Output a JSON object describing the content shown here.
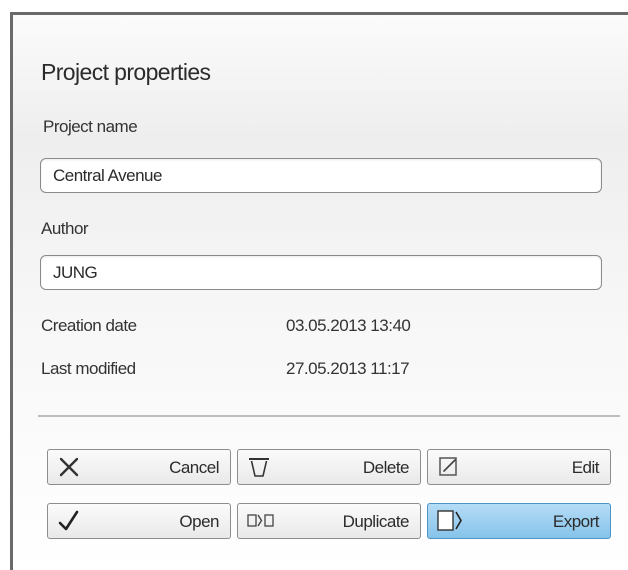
{
  "panel": {
    "title": "Project properties"
  },
  "form": {
    "project_name_label": "Project name",
    "project_name_value": "Central Avenue",
    "author_label": "Author",
    "author_value": "JUNG",
    "creation_date_label": "Creation date",
    "creation_date_value": "03.05.2013 13:40",
    "last_modified_label": "Last modified",
    "last_modified_value": "27.05.2013 11:17"
  },
  "buttons": {
    "cancel": {
      "label": "Cancel",
      "icon": "close-x-icon"
    },
    "delete": {
      "label": "Delete",
      "icon": "trash-icon"
    },
    "edit": {
      "label": "Edit",
      "icon": "edit-pencil-icon"
    },
    "open": {
      "label": "Open",
      "icon": "checkmark-icon"
    },
    "duplicate": {
      "label": "Duplicate",
      "icon": "duplicate-icon"
    },
    "export": {
      "label": "Export",
      "icon": "export-icon",
      "selected": true
    }
  },
  "colors": {
    "accent_selected": "#9ed0f0",
    "panel_border": "#6a6a6a",
    "text": "#2b2b2b"
  }
}
